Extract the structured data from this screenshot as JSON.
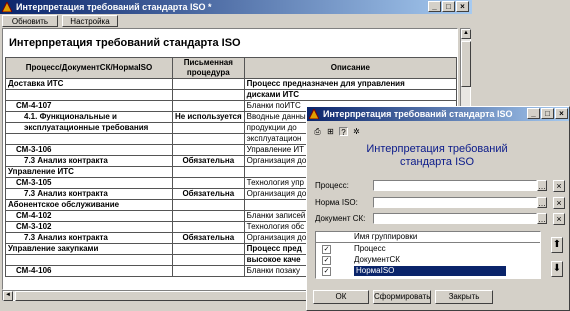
{
  "main_window": {
    "title": "Интерпретация требований стандарта ISO *",
    "menu": [
      "Обновить",
      "Настройка"
    ],
    "heading": "Интерпретация требований стандарта ISO",
    "columns": [
      "Процесс/ДокументСК/НормаISO",
      "Письменная процедура",
      "Описание"
    ],
    "rows": [
      {
        "type": "grp",
        "c1": "Доставка ИТС",
        "c2": "",
        "c3": "Процесс предназначен для управления"
      },
      {
        "type": "grp2",
        "c1": "",
        "c2": "",
        "c3": "дисками ИТС"
      },
      {
        "type": "l1",
        "c1": "СМ-4-107",
        "c2": "",
        "c3": "Бланки поИТС"
      },
      {
        "type": "l2",
        "c1": "4.1. Функциональные и",
        "c2": "Не используется",
        "c3": "Вводные данные"
      },
      {
        "type": "l2",
        "c1": "эксплуатационные требования",
        "c2": "",
        "c3": "продукции до"
      },
      {
        "type": "l2",
        "c1": "",
        "c2": "",
        "c3": "эксплуатацион"
      },
      {
        "type": "l1",
        "c1": "СМ-3-106",
        "c2": "",
        "c3": "Управление ИТ"
      },
      {
        "type": "l2",
        "c1": "7.3 Анализ контракта",
        "c2": "Обязательна",
        "c3": "Организация до"
      },
      {
        "type": "grp",
        "c1": "Управление ИТС",
        "c2": "",
        "c3": ""
      },
      {
        "type": "l1",
        "c1": "СМ-3-105",
        "c2": "",
        "c3": "Технология упр"
      },
      {
        "type": "l2",
        "c1": "7.3 Анализ контракта",
        "c2": "Обязательна",
        "c3": "Организация до"
      },
      {
        "type": "grp",
        "c1": "Абонентское обслуживание",
        "c2": "",
        "c3": ""
      },
      {
        "type": "l1",
        "c1": "СМ-4-102",
        "c2": "",
        "c3": "Бланки записей"
      },
      {
        "type": "l1",
        "c1": "СМ-3-102",
        "c2": "",
        "c3": "Технология обс"
      },
      {
        "type": "l2",
        "c1": "7.3 Анализ контракта",
        "c2": "Обязательна",
        "c3": "Организация до"
      },
      {
        "type": "grp",
        "c1": "Управление закупками",
        "c2": "",
        "c3": "Процесс пред"
      },
      {
        "type": "grp2",
        "c1": "",
        "c2": "",
        "c3": "высокое каче"
      },
      {
        "type": "l1",
        "c1": "СМ-4-106",
        "c2": "",
        "c3": "Бланки позаку"
      }
    ]
  },
  "dialog": {
    "title": "Интерпретация требований стандарта ISO",
    "heading_line1": "Интерпретация требований",
    "heading_line2": "стандарта ISO",
    "fields": [
      {
        "label": "Процесс:",
        "value": ""
      },
      {
        "label": "Норма ISO:",
        "value": ""
      },
      {
        "label": "Документ СК:",
        "value": ""
      }
    ],
    "list_header": "Имя группировки",
    "list_items": [
      {
        "label": "Процесс",
        "checked": true,
        "selected": false
      },
      {
        "label": "ДокументСК",
        "checked": true,
        "selected": false
      },
      {
        "label": "НормаISO",
        "checked": true,
        "selected": true
      }
    ],
    "buttons": {
      "ok": "ОК",
      "form": "Сформировать",
      "close": "Закрыть"
    }
  },
  "colors": {
    "titlebar": "#0a246a",
    "heading": "#0a1a8a",
    "face": "#d4d0c8"
  }
}
